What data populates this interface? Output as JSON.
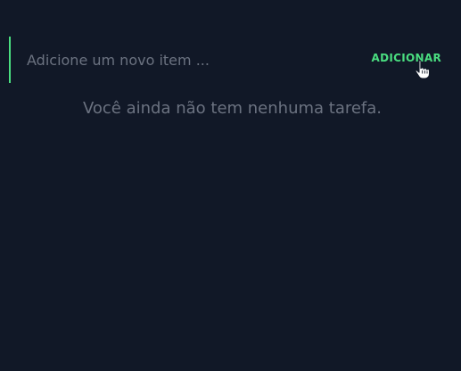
{
  "task_form": {
    "input_value": "",
    "input_placeholder": "Adicione um novo item ...",
    "add_button_label": "ADICIONAR"
  },
  "task_list": {
    "empty_message": "Você ainda não tem nenhuma tarefa.",
    "items": []
  },
  "cursor": {
    "icon": "hand-pointer-icon"
  },
  "colors": {
    "background": "#111827",
    "accent": "#4ade80",
    "placeholder": "#6b7280",
    "empty_text": "#6b7280"
  }
}
